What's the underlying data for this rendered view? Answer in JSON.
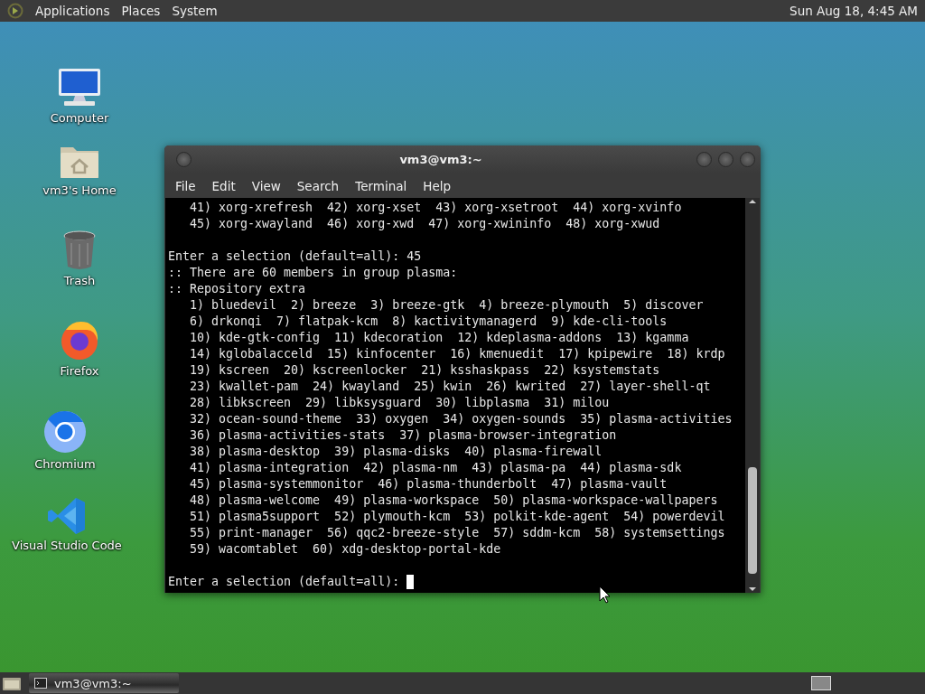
{
  "top_panel": {
    "menus": [
      "Applications",
      "Places",
      "System"
    ],
    "clock": "Sun Aug 18, 4:45 AM"
  },
  "desktop_icons": [
    {
      "kind": "computer",
      "label": "Computer"
    },
    {
      "kind": "home",
      "label": "vm3's Home"
    },
    {
      "kind": "trash",
      "label": "Trash"
    },
    {
      "kind": "firefox",
      "label": "Firefox"
    },
    {
      "kind": "chromium",
      "label": "Chromium"
    },
    {
      "kind": "vscode",
      "label": "Visual Studio Code"
    }
  ],
  "terminal": {
    "title": "vm3@vm3:~",
    "menu": [
      "File",
      "Edit",
      "View",
      "Search",
      "Terminal",
      "Help"
    ],
    "blocks": [
      [
        "   41) xorg-xrefresh  42) xorg-xset  43) xorg-xsetroot  44) xorg-xvinfo",
        "   45) xorg-xwayland  46) xorg-xwd  47) xorg-xwininfo  48) xorg-xwud"
      ],
      [
        "Enter a selection (default=all): 45",
        ":: There are 60 members in group plasma:",
        ":: Repository extra",
        "   1) bluedevil  2) breeze  3) breeze-gtk  4) breeze-plymouth  5) discover",
        "   6) drkonqi  7) flatpak-kcm  8) kactivitymanagerd  9) kde-cli-tools",
        "   10) kde-gtk-config  11) kdecoration  12) kdeplasma-addons  13) kgamma",
        "   14) kglobalacceld  15) kinfocenter  16) kmenuedit  17) kpipewire  18) krdp",
        "   19) kscreen  20) kscreenlocker  21) ksshaskpass  22) ksystemstats",
        "   23) kwallet-pam  24) kwayland  25) kwin  26) kwrited  27) layer-shell-qt",
        "   28) libkscreen  29) libksysguard  30) libplasma  31) milou",
        "   32) ocean-sound-theme  33) oxygen  34) oxygen-sounds  35) plasma-activities",
        "   36) plasma-activities-stats  37) plasma-browser-integration",
        "   38) plasma-desktop  39) plasma-disks  40) plasma-firewall",
        "   41) plasma-integration  42) plasma-nm  43) plasma-pa  44) plasma-sdk",
        "   45) plasma-systemmonitor  46) plasma-thunderbolt  47) plasma-vault",
        "   48) plasma-welcome  49) plasma-workspace  50) plasma-workspace-wallpapers",
        "   51) plasma5support  52) plymouth-kcm  53) polkit-kde-agent  54) powerdevil",
        "   55) print-manager  56) qqc2-breeze-style  57) sddm-kcm  58) systemsettings",
        "   59) wacomtablet  60) xdg-desktop-portal-kde"
      ],
      [
        "Enter a selection (default=all): "
      ]
    ],
    "cursor_visible": true
  },
  "taskbar": {
    "tasks": [
      {
        "label": "vm3@vm3:~",
        "selected": true
      }
    ]
  }
}
